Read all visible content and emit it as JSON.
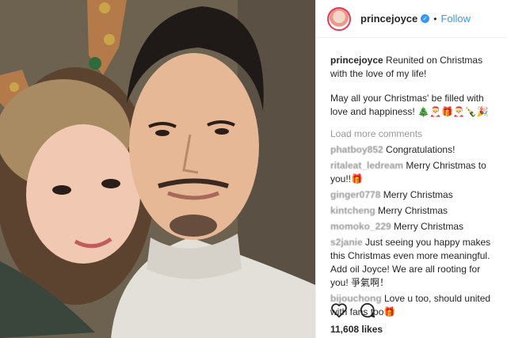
{
  "colors": {
    "link": "#3897f0",
    "muted": "#999999",
    "text": "#262626",
    "story_ring": "#e23c5b"
  },
  "photo": {
    "icon": "selfie-photo"
  },
  "header": {
    "username": "princejoyce",
    "verified_icon": "verified-badge-icon",
    "separator": "•",
    "follow_label": "Follow"
  },
  "caption": {
    "username": "princejoyce",
    "line1": "Reunited on Christmas with the love of my life!",
    "line2": "May all your Christmas' be filled with love and happiness! 🎄🎅🎁🎅🍾🎉"
  },
  "load_more": "Load more comments",
  "comments": [
    {
      "username": "phatboy852",
      "text": "Congratulations!"
    },
    {
      "username": "ritaleat_ledream",
      "text": "Merry Christmas to you!!🎁"
    },
    {
      "username": "ginger0778",
      "text": "Merry Christmas"
    },
    {
      "username": "kintcheng",
      "text": "Merry Christmas"
    },
    {
      "username": "momoko_229",
      "text": "Merry Christmas"
    },
    {
      "username": "s2janie",
      "text": "Just seeing you happy makes this Christmas even more meaningful. Add oil Joyce! We are all rooting for you! 爭氣啊！"
    },
    {
      "username": "bijouchong",
      "text": "Love u too, should united with fans too🎁"
    }
  ],
  "likes": "11,608 likes"
}
